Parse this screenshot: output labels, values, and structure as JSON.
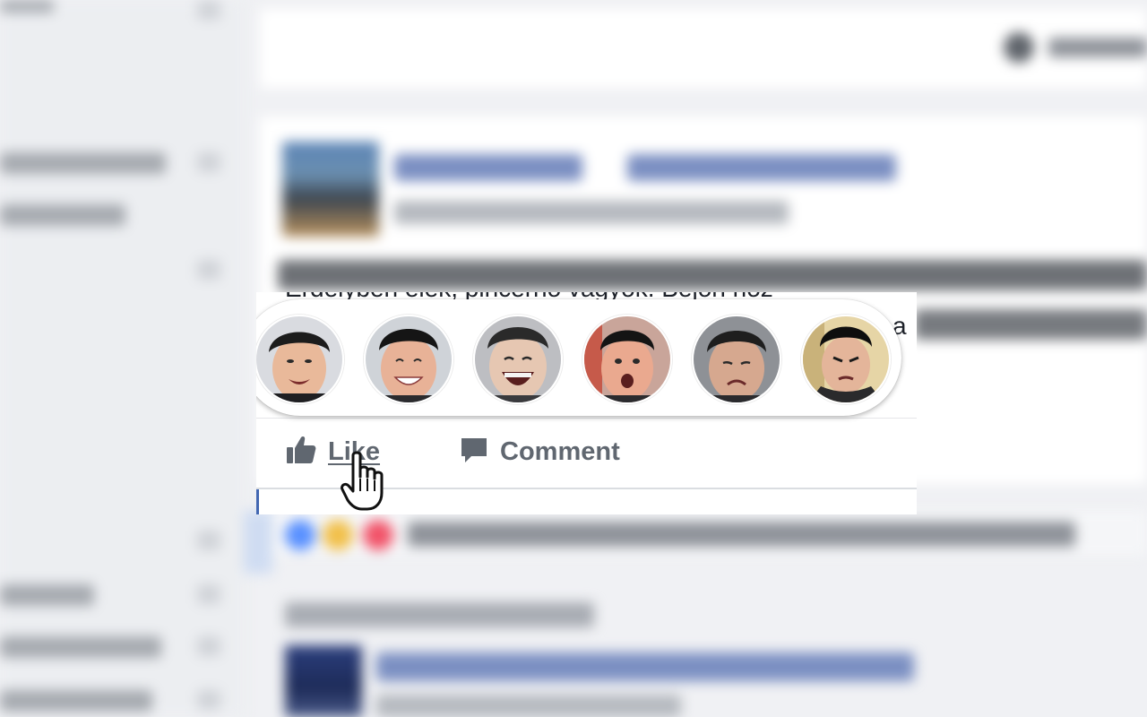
{
  "post": {
    "text_line1": "Erdélyben élek, pincérnő vagyok. Bejön hoz",
    "text_line2_fragment": "a"
  },
  "reactions": [
    {
      "id": "like",
      "icon": "face-smiling-icon"
    },
    {
      "id": "love",
      "icon": "face-grinning-icon"
    },
    {
      "id": "haha",
      "icon": "face-laughing-icon"
    },
    {
      "id": "wow",
      "icon": "face-surprised-icon"
    },
    {
      "id": "sad",
      "icon": "face-sad-icon"
    },
    {
      "id": "angry",
      "icon": "face-angry-icon"
    }
  ],
  "actions": {
    "like_label": "Like",
    "like_icon": "thumbs-up-icon",
    "comment_label": "Comment",
    "comment_icon": "speech-bubble-icon"
  },
  "colors": {
    "action_text": "#606770",
    "link_blue": "#4267b2",
    "panel_bg": "#ffffff",
    "page_bg": "#f0f1f4"
  },
  "cursor": "hand-pointer-icon"
}
